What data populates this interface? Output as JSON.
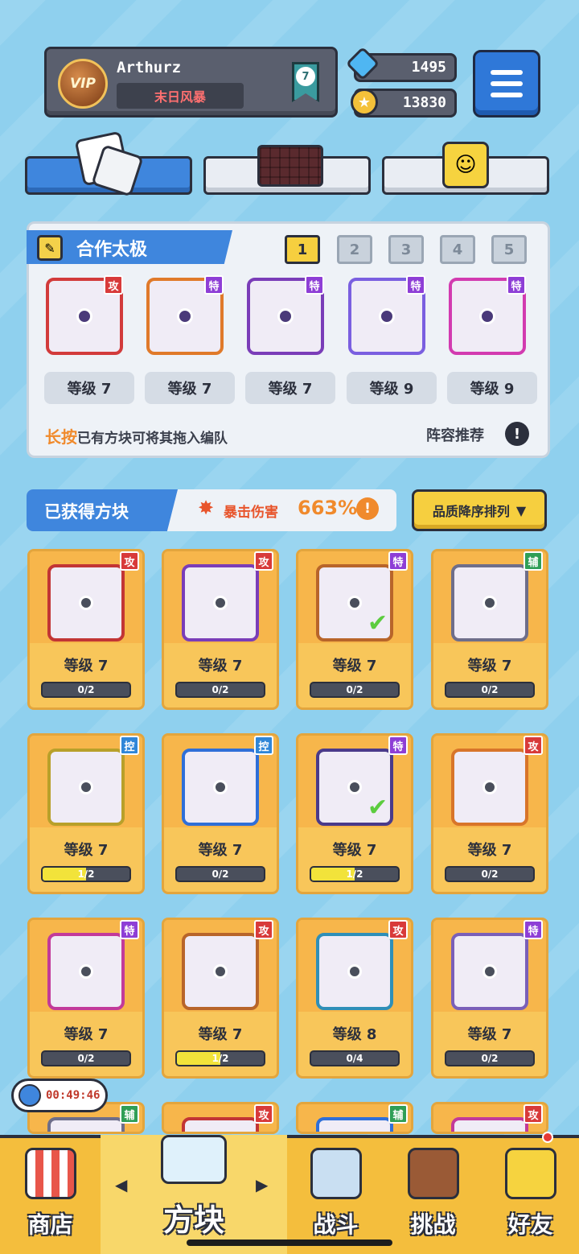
{
  "profile": {
    "vip_label": "VIP",
    "name": "Arthurz",
    "title": "末日风暴",
    "rank": "7"
  },
  "currency": {
    "gems": "1495",
    "coins": "13830"
  },
  "team": {
    "title": "合作太极",
    "slots": [
      "1",
      "2",
      "3",
      "4",
      "5"
    ],
    "active_slot": "1",
    "members": [
      {
        "tag": "攻",
        "level": "等级 7",
        "color": "#d23b3b"
      },
      {
        "tag": "特",
        "level": "等级 7",
        "color": "#e07a2a"
      },
      {
        "tag": "特",
        "level": "等级 7",
        "color": "#7a3db8"
      },
      {
        "tag": "特",
        "level": "等级 9",
        "color": "#7a5fe0"
      },
      {
        "tag": "特",
        "level": "等级 9",
        "color": "#d23bb0"
      }
    ],
    "hint_highlight": "长按",
    "hint_rest": "已有方块可将其拖入编队",
    "recommend": "阵容推荐",
    "recommend_icon": "!"
  },
  "owned": {
    "title": "已获得方块",
    "crit_label": "暴击伤害",
    "crit_value": "663%",
    "crit_icon": "!",
    "sort_label": "品质降序排列",
    "sort_arrow": "▼"
  },
  "cards": [
    {
      "tag": "攻",
      "tag_type": "att",
      "level": "等级 7",
      "progress": "0/2",
      "fill": 0,
      "color": "#c23535",
      "checked": false
    },
    {
      "tag": "攻",
      "tag_type": "att",
      "level": "等级 7",
      "progress": "0/2",
      "fill": 0,
      "color": "#7a3db8",
      "checked": false
    },
    {
      "tag": "特",
      "tag_type": "spe",
      "level": "等级 7",
      "progress": "0/2",
      "fill": 0,
      "color": "#b8652a",
      "checked": true
    },
    {
      "tag": "辅",
      "tag_type": "sup",
      "level": "等级 7",
      "progress": "0/2",
      "fill": 0,
      "color": "#6e6e8a",
      "checked": false
    },
    {
      "tag": "控",
      "tag_type": "ctl",
      "level": "等级 7",
      "progress": "1/2",
      "fill": 0.5,
      "color": "#b8a02a",
      "checked": false
    },
    {
      "tag": "控",
      "tag_type": "ctl",
      "level": "等级 7",
      "progress": "0/2",
      "fill": 0,
      "color": "#2f6fd8",
      "checked": false
    },
    {
      "tag": "特",
      "tag_type": "spe",
      "level": "等级 7",
      "progress": "1/2",
      "fill": 0.5,
      "color": "#4a3a8a",
      "checked": true
    },
    {
      "tag": "攻",
      "tag_type": "att",
      "level": "等级 7",
      "progress": "0/2",
      "fill": 0,
      "color": "#d8752a",
      "checked": false
    },
    {
      "tag": "特",
      "tag_type": "spe",
      "level": "等级 7",
      "progress": "0/2",
      "fill": 0,
      "color": "#c23a9a",
      "checked": false
    },
    {
      "tag": "攻",
      "tag_type": "att",
      "level": "等级 7",
      "progress": "1/2",
      "fill": 0.5,
      "color": "#b8652a",
      "checked": false
    },
    {
      "tag": "攻",
      "tag_type": "att",
      "level": "等级 8",
      "progress": "0/4",
      "fill": 0,
      "color": "#2f8fb8",
      "checked": false
    },
    {
      "tag": "特",
      "tag_type": "spe",
      "level": "等级 7",
      "progress": "0/2",
      "fill": 0,
      "color": "#7a5fb8",
      "checked": false
    },
    {
      "tag": "辅",
      "tag_type": "sup",
      "level": "",
      "progress": "",
      "fill": 0,
      "color": "#6e6e8a",
      "checked": false
    },
    {
      "tag": "攻",
      "tag_type": "att",
      "level": "",
      "progress": "",
      "fill": 0,
      "color": "#c23535",
      "checked": false
    },
    {
      "tag": "辅",
      "tag_type": "sup",
      "level": "",
      "progress": "",
      "fill": 0,
      "color": "#2f6fd8",
      "checked": false
    },
    {
      "tag": "攻",
      "tag_type": "att",
      "level": "",
      "progress": "",
      "fill": 0,
      "color": "#c23a9a",
      "checked": false
    }
  ],
  "timer": "00:49:46",
  "nav": {
    "shop": "商店",
    "blocks": "方块",
    "battle": "战斗",
    "challenge": "挑战",
    "friends": "好友",
    "left_arrow": "◀",
    "right_arrow": "▶"
  }
}
